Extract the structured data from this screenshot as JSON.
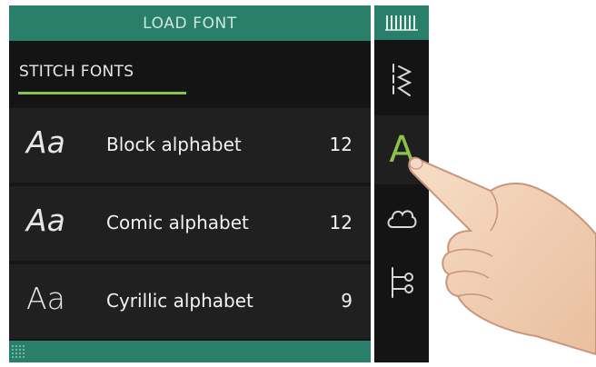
{
  "header": {
    "title": "LOAD FONT"
  },
  "section": {
    "label": "STITCH FONTS"
  },
  "fonts": [
    {
      "sample": "Aa",
      "name": "Block alphabet",
      "count": "12"
    },
    {
      "sample": "Aa",
      "name": "Comic alphabet",
      "count": "12"
    },
    {
      "sample": "Aa",
      "name": "Cyrillic alphabet",
      "count": "9"
    }
  ],
  "sidebar": {
    "items": [
      {
        "icon": "stitch-icon"
      },
      {
        "icon": "font-letter-a-icon",
        "label": "A",
        "active": true
      },
      {
        "icon": "cloud-icon"
      },
      {
        "icon": "settings-sliders-icon"
      }
    ]
  },
  "colors": {
    "accent": "#2a7f6a",
    "highlight": "#8bc34a",
    "background": "#161616"
  }
}
